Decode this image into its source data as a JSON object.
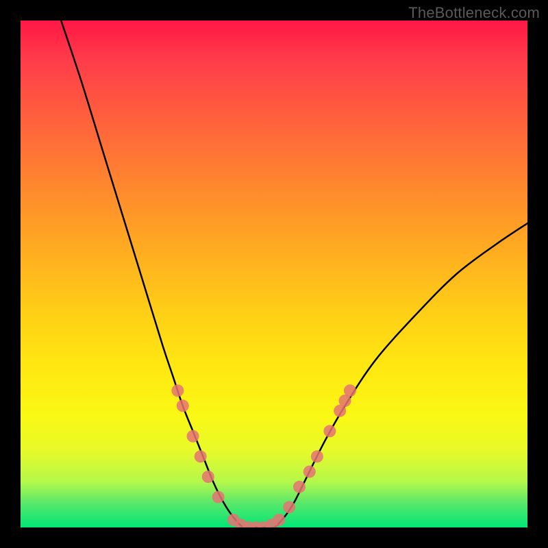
{
  "watermark": "TheBottleneck.com",
  "chart_data": {
    "type": "line",
    "title": "",
    "xlabel": "",
    "ylabel": "",
    "xlim": [
      0,
      100
    ],
    "ylim": [
      0,
      100
    ],
    "grid": false,
    "legend": false,
    "series": [
      {
        "name": "bottleneck-curve",
        "x": [
          8,
          12,
          16,
          20,
          24,
          28,
          30,
          32,
          34,
          36,
          38,
          40,
          42,
          44,
          46,
          48,
          50,
          52,
          54,
          56,
          60,
          64,
          70,
          78,
          86,
          94,
          100
        ],
        "y": [
          100,
          88,
          75,
          62,
          49,
          36,
          30,
          24,
          19,
          14,
          9,
          5,
          2,
          0,
          0,
          0,
          0,
          2,
          5,
          9,
          17,
          24,
          33,
          42,
          50,
          56,
          60
        ]
      }
    ],
    "markers": {
      "name": "highlight-dots",
      "points": [
        {
          "x": 31,
          "y": 27
        },
        {
          "x": 32,
          "y": 24
        },
        {
          "x": 34,
          "y": 18
        },
        {
          "x": 35.5,
          "y": 14
        },
        {
          "x": 37,
          "y": 10
        },
        {
          "x": 39,
          "y": 6
        },
        {
          "x": 42,
          "y": 1.5
        },
        {
          "x": 43.5,
          "y": 0.5
        },
        {
          "x": 45,
          "y": 0
        },
        {
          "x": 46.5,
          "y": 0
        },
        {
          "x": 48,
          "y": 0
        },
        {
          "x": 49.5,
          "y": 0.5
        },
        {
          "x": 51,
          "y": 1.5
        },
        {
          "x": 53,
          "y": 4
        },
        {
          "x": 55,
          "y": 8
        },
        {
          "x": 57,
          "y": 11
        },
        {
          "x": 58.5,
          "y": 14
        },
        {
          "x": 61,
          "y": 19
        },
        {
          "x": 63,
          "y": 23
        },
        {
          "x": 64,
          "y": 25
        },
        {
          "x": 65,
          "y": 27
        }
      ]
    },
    "gradient_colors": {
      "top": "#ff1744",
      "mid_upper": "#ff9728",
      "mid": "#ffe712",
      "mid_lower": "#b4f84a",
      "bottom": "#00e676"
    }
  }
}
